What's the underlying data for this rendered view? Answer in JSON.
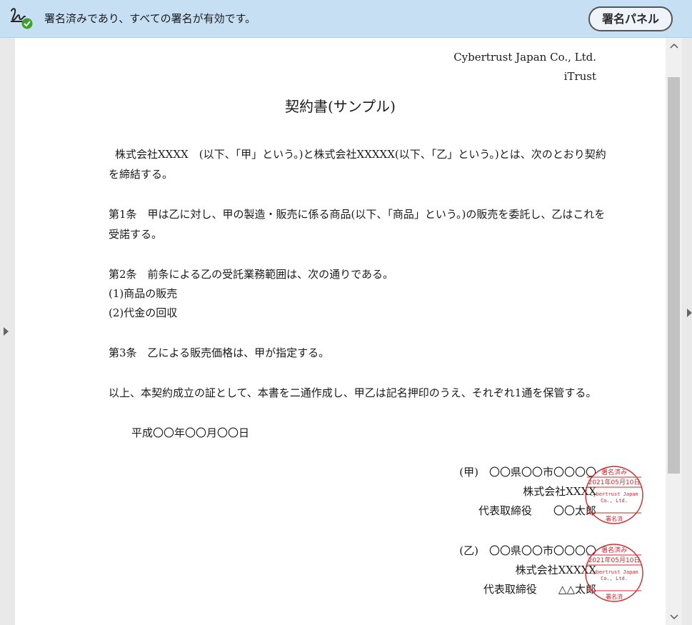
{
  "signature_bar": {
    "icon": "signature-valid-icon",
    "message": "署名済みであり、すべての署名が有効です。",
    "panel_button": "署名パネル",
    "status_color": "#3aa325"
  },
  "document": {
    "header_company": "Cybertrust Japan Co., Ltd.",
    "header_product": "iTrust",
    "title": "契約書(サンプル)",
    "intro_line1": "株式会社XXXX　(以下、「甲」という。)と株式会社XXXXX(以下、「乙」という。)とは、次のとおり契約",
    "intro_line2": "を締結する。",
    "art1_line1": "第1条　甲は乙に対し、甲の製造・販売に係る商品(以下、「商品」という。)の販売を委託し、乙はこれを",
    "art1_line2": "受諾する。",
    "art2_line1": "第2条　前条による乙の受託業務範囲は、次の通りである。",
    "art2_item1": "(1)商品の販売",
    "art2_item2": "(2)代金の回収",
    "art3": "第3条　乙による販売価格は、甲が指定する。",
    "closing": "以上、本契約成立の証として、本書を二通作成し、甲乙は記名押印のうえ、それぞれ1通を保管する。",
    "date": "平成〇〇年〇〇月〇〇日",
    "party_a": {
      "address": "(甲)　〇〇県〇〇市〇〇〇〇",
      "company": "株式会社XXXX",
      "representative": "代表取締役　　〇〇太郎"
    },
    "party_b": {
      "address": "(乙)　〇〇県〇〇市〇〇〇〇",
      "company": "株式会社XXXXX",
      "representative": "代表取締役　　△△太郎"
    },
    "stamp": {
      "top_text": "署名済み",
      "date_text": "2021年05月10日",
      "org_line1": "Cybertrust Japan",
      "org_line2": "Co., Ltd.",
      "bottom_text": "署名済",
      "color": "#d8262b"
    }
  },
  "scrollbar": {
    "up_glyph": "^",
    "down_glyph": "v"
  }
}
